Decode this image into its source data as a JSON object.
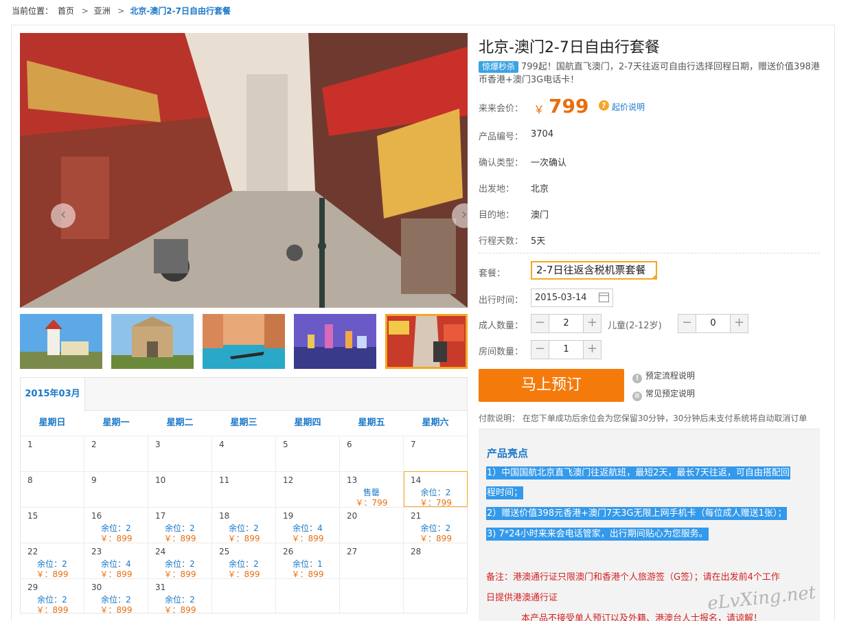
{
  "breadcrumb": {
    "label": "当前位置：",
    "items": [
      "首页",
      "亚洲"
    ],
    "sep": ">",
    "current": "北京-澳门2-7日自由行套餐"
  },
  "gallery": {
    "prev_icon": "‹",
    "next_icon": "›",
    "thumbnails": [
      "lighthouse",
      "ruins-of-st-paul",
      "venetian-gondola",
      "night-skyline",
      "street-market"
    ],
    "active_thumbnail": 4
  },
  "calendar": {
    "month": "2015年03月",
    "weekdays": [
      "星期日",
      "星期一",
      "星期二",
      "星期三",
      "星期四",
      "星期五",
      "星期六"
    ],
    "days": [
      {
        "d": "1"
      },
      {
        "d": "2"
      },
      {
        "d": "3"
      },
      {
        "d": "4"
      },
      {
        "d": "5"
      },
      {
        "d": "6"
      },
      {
        "d": "7"
      },
      {
        "d": "8"
      },
      {
        "d": "9"
      },
      {
        "d": "10"
      },
      {
        "d": "11"
      },
      {
        "d": "12"
      },
      {
        "d": "13",
        "seat": "售罄",
        "price": "￥：799"
      },
      {
        "d": "14",
        "seat": "余位：2",
        "price": "￥：799",
        "selected": true
      },
      {
        "d": "15"
      },
      {
        "d": "16",
        "seat": "余位：2",
        "price": "￥：899"
      },
      {
        "d": "17",
        "seat": "余位：2",
        "price": "￥：899"
      },
      {
        "d": "18",
        "seat": "余位：2",
        "price": "￥：899"
      },
      {
        "d": "19",
        "seat": "余位：4",
        "price": "￥：899"
      },
      {
        "d": "20"
      },
      {
        "d": "21",
        "seat": "余位：2",
        "price": "￥：899"
      },
      {
        "d": "22",
        "seat": "余位：2",
        "price": "￥：899"
      },
      {
        "d": "23",
        "seat": "余位：4",
        "price": "￥：899"
      },
      {
        "d": "24",
        "seat": "余位：2",
        "price": "￥：899"
      },
      {
        "d": "25",
        "seat": "余位：2",
        "price": "￥：899"
      },
      {
        "d": "26",
        "seat": "余位：1",
        "price": "￥：899"
      },
      {
        "d": "27"
      },
      {
        "d": "28"
      },
      {
        "d": "29",
        "seat": "余位：2",
        "price": "￥：899"
      },
      {
        "d": "30",
        "seat": "余位：2",
        "price": "￥：899"
      },
      {
        "d": "31",
        "seat": "余位：2",
        "price": "￥：899"
      },
      {
        "d": ""
      },
      {
        "d": ""
      },
      {
        "d": ""
      },
      {
        "d": ""
      }
    ]
  },
  "product": {
    "title": "北京-澳门2-7日自由行套餐",
    "promo_tag": "惊爆秒杀",
    "promo_text": "799起！国航直飞澳门，2-7天往返可自由行选择回程日期，赠送价值398港币香港+澳门3G电话卡！",
    "price_label": "来来会价：",
    "currency": "￥",
    "price": "799",
    "price_help_icon": "?",
    "price_help": "起价说明",
    "info": [
      {
        "label": "产品编号：",
        "value": "3704"
      },
      {
        "label": "确认类型：",
        "value": "一次确认"
      },
      {
        "label": "出发地：",
        "value": "北京"
      },
      {
        "label": "目的地：",
        "value": "澳门"
      },
      {
        "label": "行程天数：",
        "value": "5天"
      }
    ]
  },
  "booking": {
    "package_label": "套餐：",
    "package_value": "2-7日往返含税机票套餐",
    "date_label": "出行时间：",
    "date_value": "2015-03-14",
    "adult_label": "成人数量：",
    "adult_value": "2",
    "child_label": "儿童(2-12岁)",
    "child_value": "0",
    "room_label": "房间数量：",
    "room_value": "1",
    "minus": "−",
    "plus": "+",
    "book_button": "马上预订",
    "help_1": "预定流程说明",
    "help_2": "常见预定说明",
    "pay_note": "付款说明： 在您下单成功后余位会为您保留30分钟，30分钟后未支付系统将自动取消订单"
  },
  "highlights": {
    "title": "产品亮点",
    "lines": [
      "1）中国国航北京直飞澳门往返航班，最短2天，最长7天往返，可自由搭配回",
      "程时间；",
      "2）赠送价值398元香港+澳门7天3G无限上网手机卡（每位成人赠送1张）；",
      "3)  7*24小时来来会电话管家，出行期间贴心为您服务。"
    ],
    "note_1": "备注：港澳通行证只限澳门和香港个人旅游签（G签）；请在出发前4个工作",
    "note_2": "日提供港澳通行证",
    "note_3": "本产品不接受单人预订以及外籍、港澳台人士报名，请谅解！"
  },
  "watermark": "eLvXing.net",
  "colors": {
    "link": "#1a78c8",
    "price": "#e86e0e",
    "accent": "#f5a623",
    "button": "#f57a0c",
    "highlight": "#3399ea",
    "note": "#d42020"
  }
}
